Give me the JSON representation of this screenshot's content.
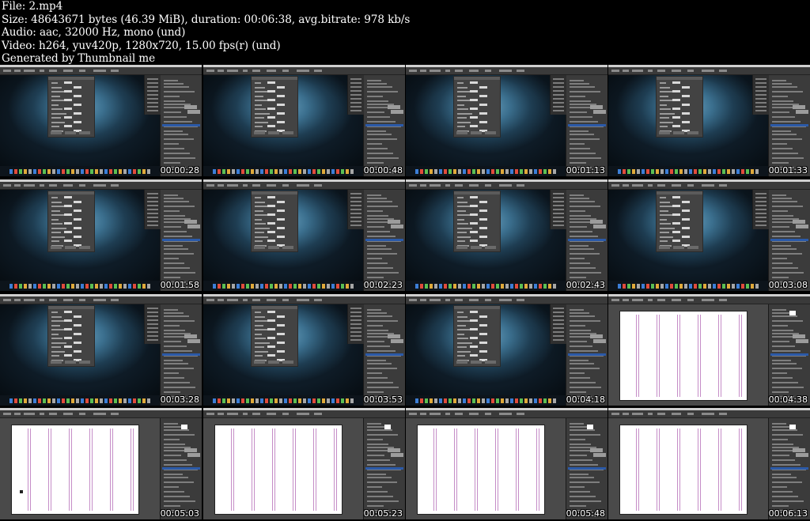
{
  "header": {
    "file": "File: 2.mp4",
    "size": "Size: 48643671 bytes (46.39 MiB), duration: 00:06:38, avg.bitrate: 978 kb/s",
    "audio": "Audio: aac, 32000 Hz, mono (und)",
    "video": "Video: h264, yuv420p, 1280x720, 15.00 fps(r) (und)",
    "generator": "Generated by Thumbnail me"
  },
  "thumbnails": [
    {
      "timestamp": "00:00:28",
      "view": "desktop-dialog"
    },
    {
      "timestamp": "00:00:48",
      "view": "desktop-dialog"
    },
    {
      "timestamp": "00:01:13",
      "view": "desktop-dialog"
    },
    {
      "timestamp": "00:01:33",
      "view": "desktop-dialog"
    },
    {
      "timestamp": "00:01:58",
      "view": "desktop-dialog"
    },
    {
      "timestamp": "00:02:23",
      "view": "desktop-dialog"
    },
    {
      "timestamp": "00:02:43",
      "view": "desktop-dialog"
    },
    {
      "timestamp": "00:03:08",
      "view": "desktop-dialog"
    },
    {
      "timestamp": "00:03:28",
      "view": "desktop-dialog"
    },
    {
      "timestamp": "00:03:53",
      "view": "desktop-dialog"
    },
    {
      "timestamp": "00:04:18",
      "view": "desktop-dialog"
    },
    {
      "timestamp": "00:04:38",
      "view": "document-page"
    },
    {
      "timestamp": "00:05:03",
      "view": "document-page"
    },
    {
      "timestamp": "00:05:23",
      "view": "document-page"
    },
    {
      "timestamp": "00:05:48",
      "view": "document-page"
    },
    {
      "timestamp": "00:06:13",
      "view": "document-page"
    }
  ],
  "colors": {
    "background": "#000000",
    "wallpaper_center": "#6aa2c0",
    "wallpaper_edge": "#0e1b26",
    "panel": "#3b3b3b",
    "column_guide": "#c58dc7",
    "selection": "#2b5aa8"
  }
}
